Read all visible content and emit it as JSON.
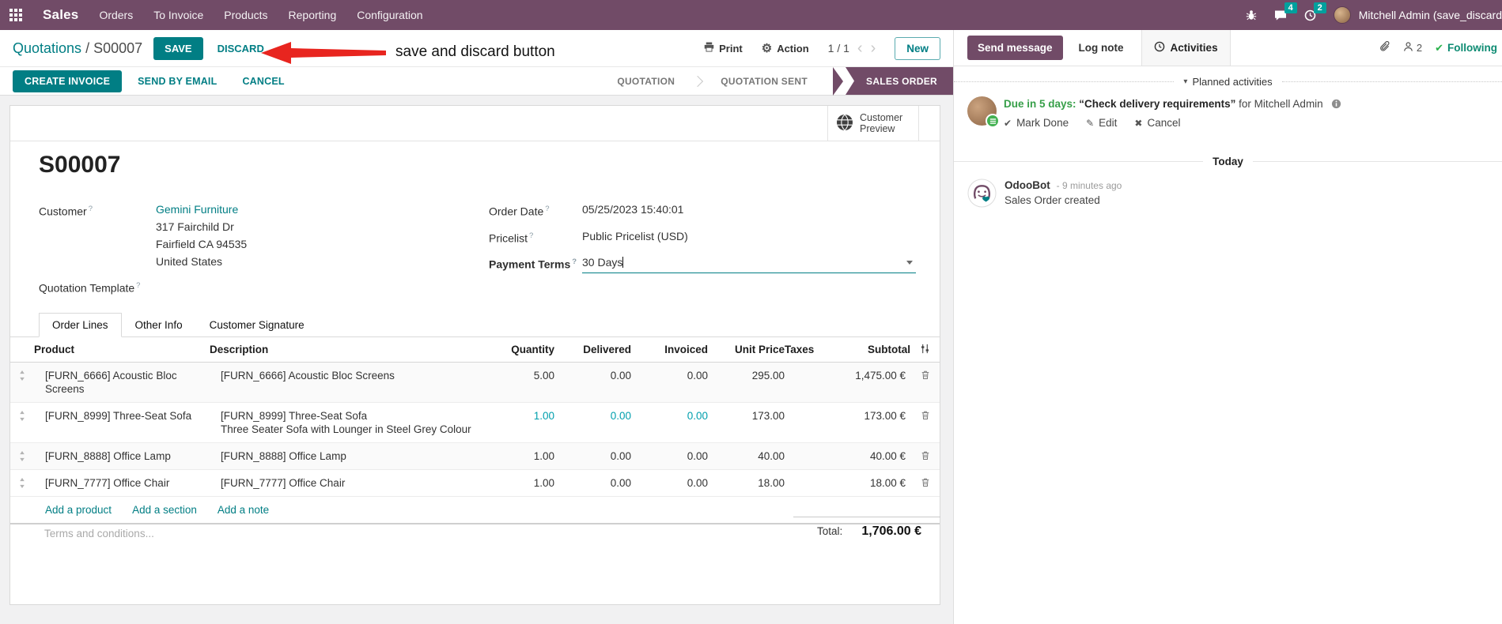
{
  "nav": {
    "app_name": "Sales",
    "menus": [
      "Orders",
      "To Invoice",
      "Products",
      "Reporting",
      "Configuration"
    ],
    "messages_badge": "4",
    "activities_badge": "2",
    "user_name": "Mitchell Admin (save_discard"
  },
  "control_panel": {
    "breadcrumb_parent": "Quotations",
    "breadcrumb_sep": "/",
    "breadcrumb_current": "S00007",
    "save_label": "SAVE",
    "discard_label": "DISCARD",
    "print_label": "Print",
    "action_label": "Action",
    "pager_value": "1 / 1",
    "pager_prev": "‹",
    "pager_next": "›",
    "new_label": "New"
  },
  "annotation": {
    "text": "save and discard button",
    "arrow_color": "#e8251f"
  },
  "statusbar": {
    "buttons": [
      "CREATE INVOICE",
      "SEND BY EMAIL",
      "CANCEL"
    ],
    "stages": [
      "QUOTATION",
      "QUOTATION SENT",
      "SALES ORDER"
    ],
    "active_stage": "SALES ORDER"
  },
  "sheet": {
    "help_marker": "?",
    "customer_preview_label": "Customer Preview",
    "title": "S00007",
    "fields": {
      "customer_label": "Customer",
      "customer_name": "Gemini Furniture",
      "address_line1": "317 Fairchild Dr",
      "address_line2": "Fairfield CA 94535",
      "address_line3": "United States",
      "quotation_template_label": "Quotation Template",
      "order_date_label": "Order Date",
      "order_date_value": "05/25/2023 15:40:01",
      "pricelist_label": "Pricelist",
      "pricelist_value": "Public Pricelist (USD)",
      "payment_terms_label": "Payment Terms",
      "payment_terms_value": "30 Days"
    },
    "tabs": [
      "Order Lines",
      "Other Info",
      "Customer Signature"
    ],
    "columns": {
      "product": "Product",
      "description": "Description",
      "quantity": "Quantity",
      "delivered": "Delivered",
      "invoiced": "Invoiced",
      "unit_price": "Unit Price",
      "taxes": "Taxes",
      "subtotal": "Subtotal"
    },
    "rows": [
      {
        "product": "[FURN_6666] Acoustic Bloc Screens",
        "description": "[FURN_6666] Acoustic Bloc Screens",
        "description2": "",
        "quantity": "5.00",
        "delivered": "0.00",
        "invoiced": "0.00",
        "unit_price": "295.00",
        "taxes": "",
        "subtotal": "1,475.00 €"
      },
      {
        "product": "[FURN_8999] Three-Seat Sofa",
        "description": "[FURN_8999] Three-Seat Sofa",
        "description2": "Three Seater Sofa with Lounger in Steel Grey Colour",
        "quantity": "1.00",
        "delivered": "0.00",
        "invoiced": "0.00",
        "unit_price": "173.00",
        "taxes": "",
        "subtotal": "173.00 €"
      },
      {
        "product": "[FURN_8888] Office Lamp",
        "description": "[FURN_8888] Office Lamp",
        "description2": "",
        "quantity": "1.00",
        "delivered": "0.00",
        "invoiced": "0.00",
        "unit_price": "40.00",
        "taxes": "",
        "subtotal": "40.00 €"
      },
      {
        "product": "[FURN_7777] Office Chair",
        "description": "[FURN_7777] Office Chair",
        "description2": "",
        "quantity": "1.00",
        "delivered": "0.00",
        "invoiced": "0.00",
        "unit_price": "18.00",
        "taxes": "",
        "subtotal": "18.00 €"
      }
    ],
    "add_links": [
      "Add a product",
      "Add a section",
      "Add a note"
    ],
    "terms_placeholder": "Terms and conditions...",
    "total_label": "Total:",
    "total_value": "1,706.00 €"
  },
  "chatter": {
    "send_message_label": "Send message",
    "log_note_label": "Log note",
    "activities_label": "Activities",
    "followers_count": "2",
    "following_check": "✔",
    "following_label": "Following",
    "planned_caret": "▾",
    "planned_header": "Planned activities",
    "activity": {
      "due": "Due in 5 days:",
      "title": "“Check delivery requirements”",
      "assignee": "for Mitchell Admin",
      "mark_done_icon": "✔",
      "mark_done": "Mark Done",
      "edit_icon": "✎",
      "edit": "Edit",
      "cancel_icon": "✖",
      "cancel": "Cancel"
    },
    "today_label": "Today",
    "message": {
      "author": "OdooBot",
      "time": "- 9 minutes ago",
      "body": "Sales Order created"
    }
  },
  "colors": {
    "navbar_bg": "#714B67",
    "primary_teal": "#017e84",
    "badge_teal": "#00A09D",
    "edited_value": "#009fad",
    "annotation_arrow": "#e8251f"
  }
}
